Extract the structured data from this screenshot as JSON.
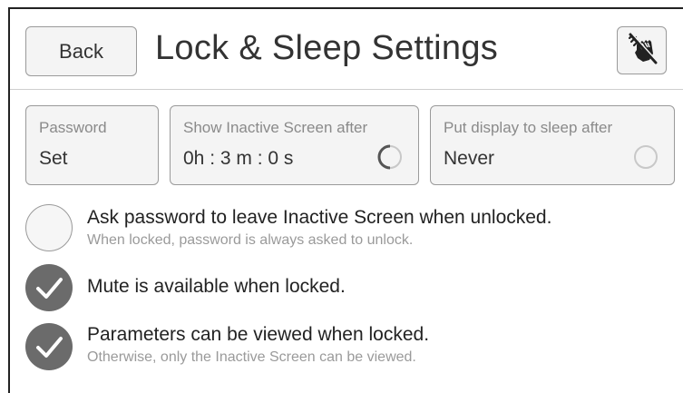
{
  "header": {
    "back_label": "Back",
    "title": "Lock & Sleep Settings",
    "mute_icon": "muted-alarm-hand-icon"
  },
  "fields": {
    "password": {
      "label": "Password",
      "value": "Set"
    },
    "inactive_screen": {
      "label": "Show Inactive Screen after",
      "value": "0h : 3 m : 0 s"
    },
    "sleep": {
      "label": "Put display to sleep after",
      "value": "Never"
    }
  },
  "options": [
    {
      "label": "Ask password to leave Inactive Screen when unlocked.",
      "sublabel": "When locked, password is always asked to unlock.",
      "checked": false
    },
    {
      "label": "Mute is available when locked.",
      "sublabel": "",
      "checked": true
    },
    {
      "label": "Parameters can be viewed when locked.",
      "sublabel": "Otherwise, only the Inactive Screen can be viewed.",
      "checked": true
    }
  ],
  "colors": {
    "checked_fill": "#6b6b6b",
    "button_bg": "#f4f4f4",
    "border": "#9a9a9a"
  }
}
